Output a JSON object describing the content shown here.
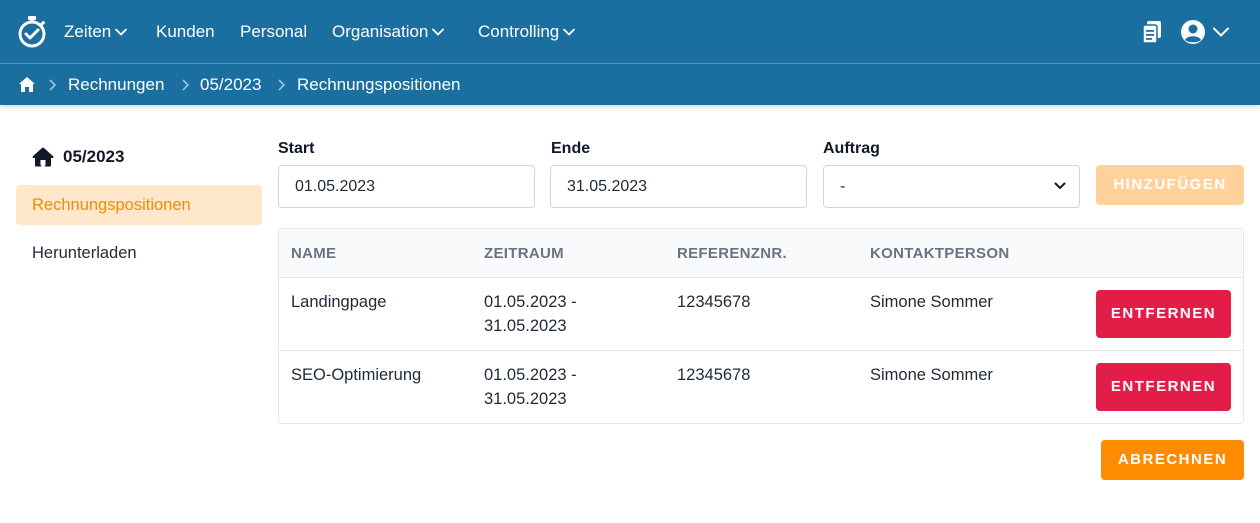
{
  "nav": {
    "items": [
      {
        "label": "Zeiten",
        "has_dropdown": true
      },
      {
        "label": "Kunden",
        "has_dropdown": false
      },
      {
        "label": "Personal",
        "has_dropdown": false
      },
      {
        "label": "Organisation",
        "has_dropdown": true
      },
      {
        "label": "Controlling",
        "has_dropdown": true
      }
    ],
    "icons": {
      "logo": "stopwatch-check-icon",
      "documents": "clipboard-copy-icon",
      "user": "user-circle-icon"
    }
  },
  "breadcrumb": {
    "home_icon": "home-icon",
    "items": [
      "Rechnungen",
      "05/2023",
      "Rechnungspositionen"
    ]
  },
  "sidebar": {
    "title": "05/2023",
    "title_icon": "home-icon",
    "items": [
      {
        "label": "Rechnungspositionen",
        "active": true
      },
      {
        "label": "Herunterladen",
        "active": false
      }
    ]
  },
  "form": {
    "start_label": "Start",
    "start_value": "01.05.2023",
    "end_label": "Ende",
    "end_value": "31.05.2023",
    "order_label": "Auftrag",
    "order_value": "-",
    "add_button": "HINZUFÜGEN"
  },
  "table": {
    "headers": [
      "NAME",
      "ZEITRAUM",
      "REFERENZNR.",
      "KONTAKTPERSON"
    ],
    "rows": [
      {
        "name": "Landingpage",
        "period_start": "01.05.2023 -",
        "period_end": "31.05.2023",
        "ref": "12345678",
        "contact": "Simone Sommer",
        "action": "ENTFERNEN"
      },
      {
        "name": "SEO-Optimierung",
        "period_start": "01.05.2023 -",
        "period_end": "31.05.2023",
        "ref": "12345678",
        "contact": "Simone Sommer",
        "action": "ENTFERNEN"
      }
    ]
  },
  "bill_button": "ABRECHNEN",
  "colors": {
    "header": "#1a6fa0",
    "accent": "#ff8c00",
    "danger": "#e11d48",
    "active_bg": "#ffe7cc"
  }
}
